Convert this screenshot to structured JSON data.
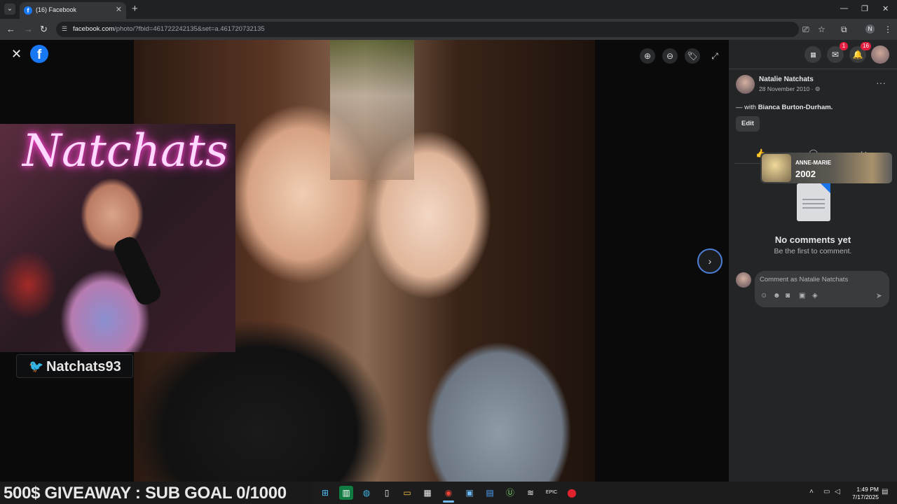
{
  "browser": {
    "tab_title": "(16) Facebook",
    "tab_favicon": "f",
    "new_tab": "+",
    "url_host": "facebook.com",
    "url_path": "/photo/?fbid=461722242135&set=a.461720732135",
    "profile_initial": "N",
    "window_controls": [
      "—",
      "❐",
      "✕"
    ]
  },
  "viewer": {
    "close": "✕",
    "logo": "f",
    "tools": [
      "⊕",
      "⊖",
      "🏷",
      "⤢"
    ],
    "next": "›"
  },
  "stream": {
    "neon_sign": "Natchats",
    "twitter_handle": "Natchats93",
    "giveaway": "500$ GIVEAWAY : SUB GOAL 0/1000"
  },
  "fb_nav": {
    "menu_icon": "⋮⋮⋮",
    "messenger_badge": "1",
    "notifications_badge": "16"
  },
  "post": {
    "author": "Natalie Natchats",
    "date": "28 November 2010 · ⚙",
    "with_prefix": "— with ",
    "with_name": "Bianca Burton-Durham.",
    "edit_label": "Edit",
    "more": "···"
  },
  "overlay_card": {
    "name": "ANNE-MARIE",
    "year": "2002"
  },
  "comments": {
    "empty_title": "No comments yet",
    "empty_subtitle": "Be the first to comment.",
    "placeholder": "Comment as Natalie Natchats",
    "send": "➤"
  },
  "taskbar": {
    "time": "1:49 PM",
    "date": "7/17/2025"
  },
  "colors": {
    "facebook_blue": "#1877f2",
    "panel_bg": "#242526",
    "badge_red": "#e41e3f",
    "twitter_blue": "#1da1f2"
  }
}
